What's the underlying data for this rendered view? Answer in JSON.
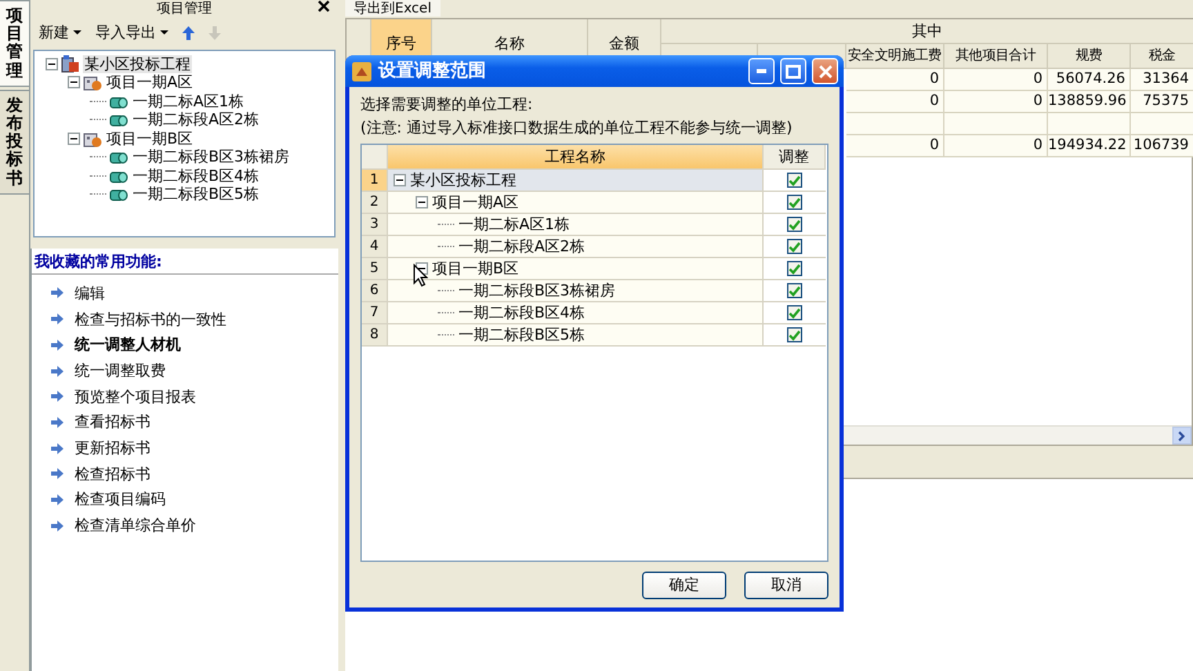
{
  "side_tabs": [
    {
      "label": "项目管理",
      "selected": true
    },
    {
      "label": "发布投标书",
      "selected": false
    }
  ],
  "panel": {
    "title": "项目管理",
    "toolbar": [
      {
        "kind": "menu",
        "label": "新建"
      },
      {
        "kind": "menu",
        "label": "导入导出"
      },
      {
        "kind": "up",
        "disabled": false
      },
      {
        "kind": "down",
        "disabled": true
      }
    ],
    "tree": [
      {
        "label": "某小区投标工程",
        "kind": "project",
        "expanded": true,
        "selected": true,
        "children": [
          {
            "label": "项目一期A区",
            "kind": "group",
            "expanded": true,
            "selected": false,
            "children": [
              {
                "label": "一期二标A区1栋",
                "kind": "unit",
                "selected": false
              },
              {
                "label": "一期二标段A区2栋",
                "kind": "unit",
                "selected": false
              }
            ]
          },
          {
            "label": "项目一期B区",
            "kind": "group",
            "expanded": true,
            "selected": false,
            "children": [
              {
                "label": "一期二标段B区3栋裙房",
                "kind": "unit",
                "selected": false
              },
              {
                "label": "一期二标段B区4栋",
                "kind": "unit",
                "selected": false
              },
              {
                "label": "一期二标段B区5栋",
                "kind": "unit",
                "selected": false
              }
            ]
          }
        ]
      }
    ],
    "favorites_title": "我收藏的常用功能:",
    "favorites": [
      {
        "label": "编辑",
        "active": false
      },
      {
        "label": "检查与招标书的一致性",
        "active": false
      },
      {
        "label": "统一调整人材机",
        "active": true
      },
      {
        "label": "统一调整取费",
        "active": false
      },
      {
        "label": "预览整个项目报表",
        "active": false
      },
      {
        "label": "查看招标书",
        "active": false
      },
      {
        "label": "更新招标书",
        "active": false
      },
      {
        "label": "检查招标书",
        "active": false
      },
      {
        "label": "检查项目编码",
        "active": false
      },
      {
        "label": "检查清单综合单价",
        "active": false
      }
    ]
  },
  "toolbar_button": "导出到Excel",
  "table": {
    "columns": [
      "序号",
      "名称",
      "金额"
    ],
    "group": {
      "label": "其中",
      "columns": [
        "安全文明施工费",
        "其他项目合计",
        "规费",
        "税金"
      ]
    },
    "rows": [
      {
        "kind": "data",
        "cells": [
          "0",
          "0",
          "56074.26",
          "31364"
        ]
      },
      {
        "kind": "data",
        "cells": [
          "0",
          "0",
          "138859.96",
          "75375"
        ]
      },
      {
        "kind": "blank"
      },
      {
        "kind": "data",
        "cells": [
          "0",
          "0",
          "194934.22",
          "106739"
        ]
      }
    ]
  },
  "dialog": {
    "title": "设置调整范围",
    "prompt": "选择需要调整的单位工程:",
    "note": "(注意: 通过导入标准接口数据生成的单位工程不能参与统一调整)",
    "columns": [
      "工程名称",
      "调整"
    ],
    "rows": [
      {
        "number": "1",
        "label": "某小区投标工程",
        "expanded": true,
        "checked": true,
        "selected": true,
        "children": [
          {
            "number": "2",
            "label": "项目一期A区",
            "expanded": true,
            "checked": true,
            "selected": false,
            "children": [
              {
                "number": "3",
                "label": "一期二标A区1栋",
                "checked": true,
                "selected": false
              },
              {
                "number": "4",
                "label": "一期二标段A区2栋",
                "checked": true,
                "selected": false
              }
            ]
          },
          {
            "number": "5",
            "label": "项目一期B区",
            "expanded": true,
            "checked": true,
            "selected": false,
            "children": [
              {
                "number": "6",
                "label": "一期二标段B区3栋裙房",
                "checked": true,
                "selected": false
              },
              {
                "number": "7",
                "label": "一期二标段B区4栋",
                "checked": true,
                "selected": false
              },
              {
                "number": "8",
                "label": "一期二标段B区5栋",
                "checked": true,
                "selected": false
              }
            ]
          }
        ]
      }
    ],
    "buttons": [
      "确定",
      "取消"
    ]
  }
}
